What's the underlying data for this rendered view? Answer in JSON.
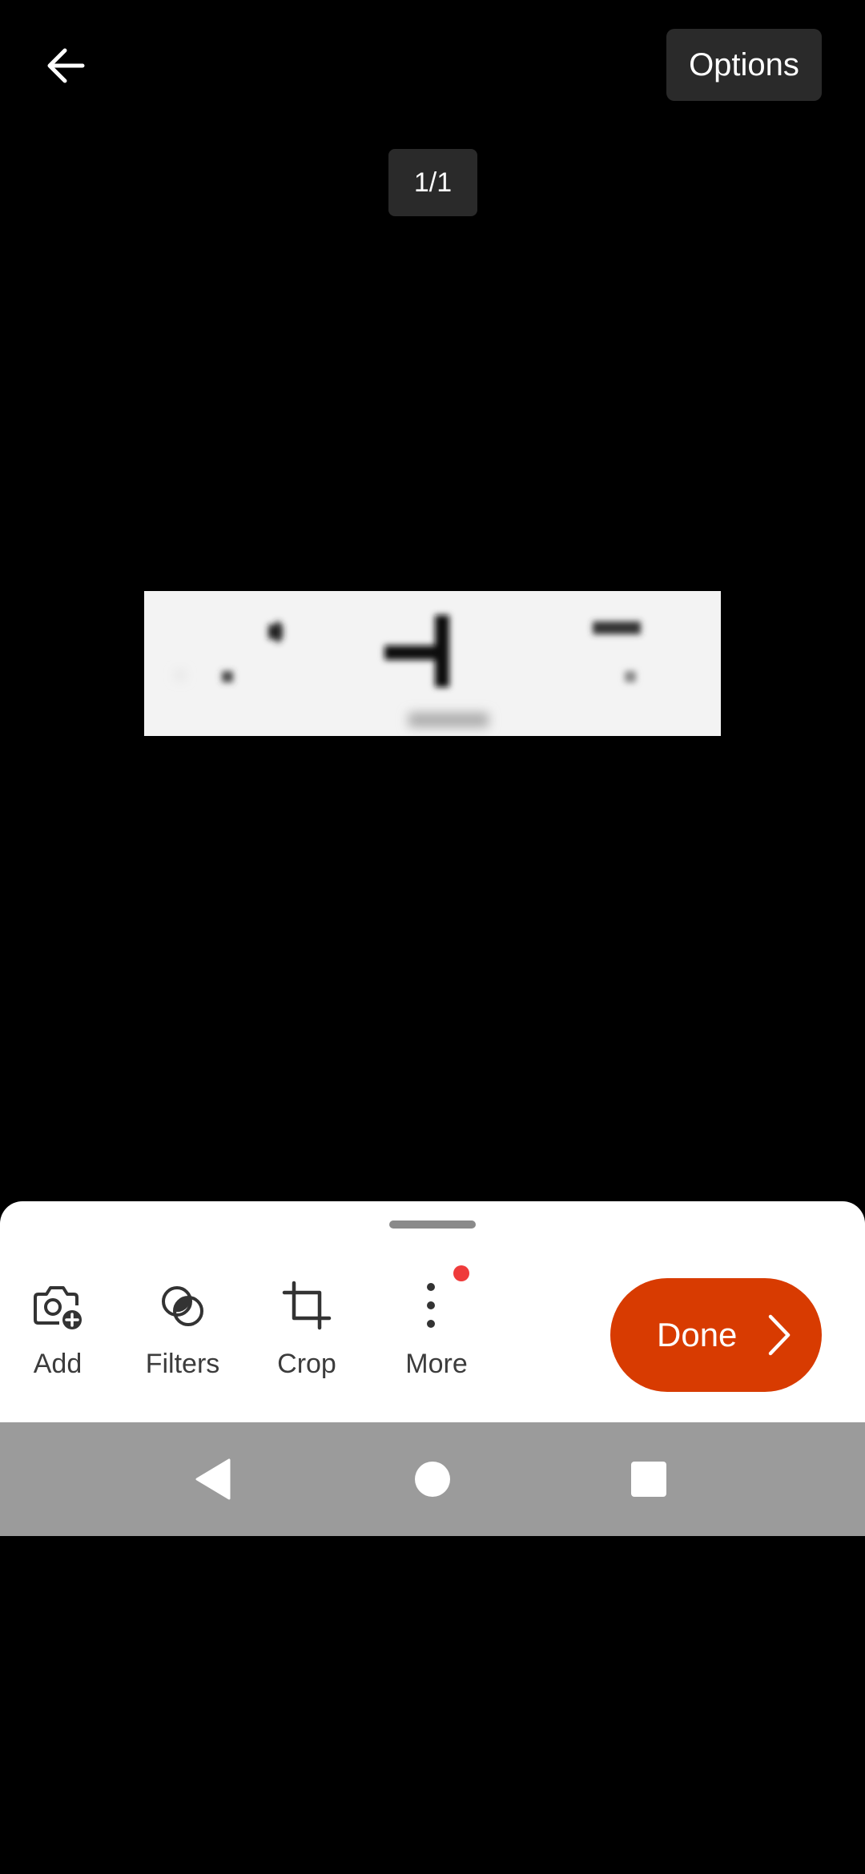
{
  "header": {
    "back_icon": "arrow-left-icon",
    "options_label": "Options"
  },
  "viewer": {
    "page_counter": "1/1"
  },
  "toolbar": {
    "tools": [
      {
        "label": "Add",
        "icon": "camera-add-icon"
      },
      {
        "label": "Filters",
        "icon": "filters-icon"
      },
      {
        "label": "Crop",
        "icon": "crop-icon"
      },
      {
        "label": "More",
        "icon": "more-vertical-icon"
      }
    ],
    "more_has_notification": true,
    "done_label": "Done",
    "done_icon": "chevron-right-icon"
  },
  "system_nav": {
    "back_icon": "nav-back-icon",
    "home_icon": "nav-home-icon",
    "recents_icon": "nav-recents-icon"
  },
  "colors": {
    "accent": "#d83b01",
    "notification": "#ef3b3b",
    "background": "#000000",
    "sheet": "#ffffff",
    "nav_bar": "#9b9b9b"
  }
}
